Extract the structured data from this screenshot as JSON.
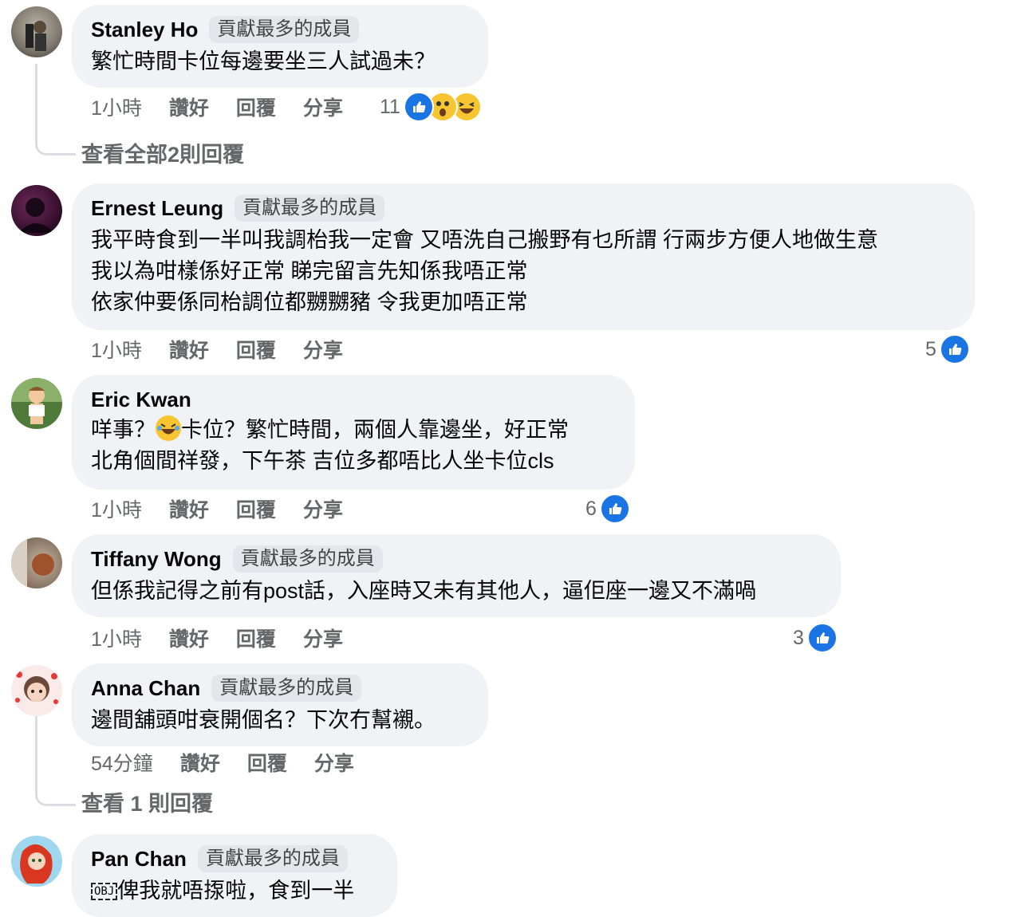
{
  "comments": [
    {
      "name": "Stanley Ho",
      "badge": "貢獻最多的成員",
      "lines": [
        "繁忙時間卡位每邊要坐三人試過未？"
      ],
      "time": "1小時",
      "like": "讚好",
      "reply": "回覆",
      "share": "分享",
      "reaction_count": "11",
      "view_replies": "查看全部2則回覆"
    },
    {
      "name": "Ernest Leung",
      "badge": "貢獻最多的成員",
      "lines": [
        "我平時食到一半叫我調枱我一定會 又唔洗自己搬野有乜所謂 行兩步方便人地做生意",
        "我以為咁樣係好正常 睇完留言先知係我唔正常",
        "依家仲要係同枱調位都嬲嬲豬 令我更加唔正常"
      ],
      "time": "1小時",
      "like": "讚好",
      "reply": "回覆",
      "share": "分享",
      "reaction_count": "5"
    },
    {
      "name": "Eric Kwan",
      "line1_a": "咩事？",
      "line1_b": "卡位？繁忙時間，兩個人靠邊坐，好正常",
      "line2": "北角個間祥發，下午茶 吉位多都唔比人坐卡位cls",
      "time": "1小時",
      "like": "讚好",
      "reply": "回覆",
      "share": "分享",
      "reaction_count": "6"
    },
    {
      "name": "Tiffany Wong",
      "badge": "貢獻最多的成員",
      "lines": [
        "但係我記得之前有post話，入座時又未有其他人，逼佢座一邊又不滿喎"
      ],
      "time": "1小時",
      "like": "讚好",
      "reply": "回覆",
      "share": "分享",
      "reaction_count": "3"
    },
    {
      "name": "Anna Chan",
      "badge": "貢獻最多的成員",
      "lines": [
        "邊間舖頭咁衰開個名？下次冇幫襯。"
      ],
      "time": "54分鐘",
      "like": "讚好",
      "reply": "回覆",
      "share": "分享",
      "view_replies": "查看 1 則回覆"
    },
    {
      "name": "Pan Chan",
      "badge": "貢獻最多的成員",
      "obj": "OBJ",
      "line1": "俾我就唔揼啦，食到一半"
    }
  ],
  "colors": {
    "bubble": "#f0f2f5",
    "like_blue": "#1b74e4",
    "meta_gray": "#65676b"
  }
}
